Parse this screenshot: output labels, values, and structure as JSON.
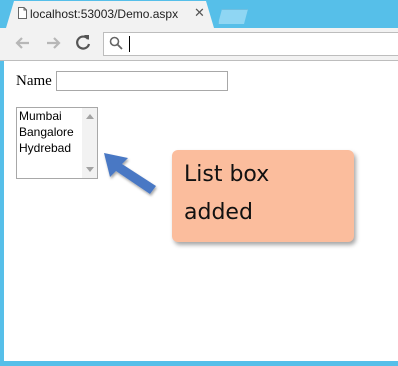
{
  "browser": {
    "tab_title": "localhost:53003/Demo.aspx",
    "address_bar_value": "",
    "icons": {
      "back": "arrow-left-icon",
      "forward": "arrow-right-icon",
      "reload": "reload-icon",
      "search": "search-icon",
      "page": "document-icon",
      "close": "close-icon"
    },
    "colors": {
      "frame": "#56bfe9",
      "toolbar": "#f2f2f2"
    }
  },
  "form": {
    "name_label": "Name",
    "name_value": "",
    "listbox_items": [
      "Mumbai",
      "Bangalore",
      "Hydrebad"
    ]
  },
  "callout": {
    "text": "List box\nadded",
    "background": "#fbbd9d",
    "arrow_color": "#4a78c4"
  }
}
